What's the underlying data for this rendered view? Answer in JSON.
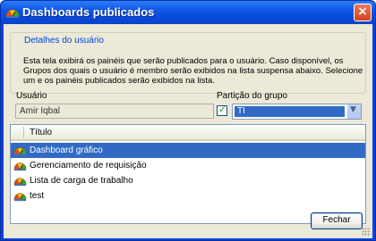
{
  "window": {
    "title": "Dashboards publicados",
    "close_label": "×"
  },
  "details": {
    "legend": "Detalhes do usuário",
    "description": "Esta tela exibirá os painéis que serão publicados para o usuário. Caso disponível, os Grupos dos quais o usuário é membro serão exibidos na lista suspensa abaixo. Selecione um e os painéis publicados serão exibidos na lista."
  },
  "form": {
    "usuario_label": "Usuário",
    "usuario_value": "Amir Iqbal",
    "particao_label": "Partição do grupo",
    "particao_checked": true,
    "particao_value": "TI"
  },
  "list": {
    "header": "Título",
    "selected_index": 0,
    "items": [
      "Dashboard gráfico",
      "Gerenciamento de requisição",
      "Lista de carga de trabalho",
      "test"
    ]
  },
  "buttons": {
    "fechar": "Fechar"
  },
  "colors": {
    "titlebar": "#0a48d8",
    "selection": "#316ac5",
    "legend_text": "#0046d5",
    "dialog_bg": "#ece9d8"
  }
}
